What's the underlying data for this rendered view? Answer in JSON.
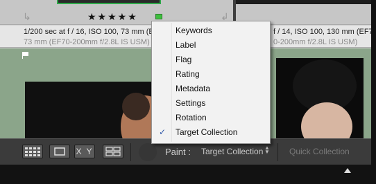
{
  "grid": {
    "left_cell": {
      "stars": "★★★★★",
      "meta_line1": "1/200 sec at f / 16, ISO 100, 73 mm (EF70-200mm f/2.8L IS USM)",
      "meta_line2": "73 mm (EF70-200mm f/2.8L IS USM)"
    },
    "right_cell": {
      "stars": "★★★★★",
      "meta_line1": "f / 14, ISO 100, 130 mm (EF70-200mm",
      "meta_line2": "0-200mm f/2.8L IS USM)"
    },
    "colors": {
      "label_green": "#3ebf3e",
      "background_green": "#8ba58a"
    }
  },
  "menu": {
    "items": [
      {
        "label": "Keywords",
        "checked": false
      },
      {
        "label": "Label",
        "checked": false
      },
      {
        "label": "Flag",
        "checked": false
      },
      {
        "label": "Rating",
        "checked": false
      },
      {
        "label": "Metadata",
        "checked": false
      },
      {
        "label": "Settings",
        "checked": false
      },
      {
        "label": "Rotation",
        "checked": false
      },
      {
        "label": "Target Collection",
        "checked": true
      }
    ],
    "check_glyph": "✓"
  },
  "toolbar": {
    "compare_label": "X Y",
    "paint_label": "Paint :",
    "paint_value": "Target Collection",
    "quick_collection": "Quick Collection"
  }
}
